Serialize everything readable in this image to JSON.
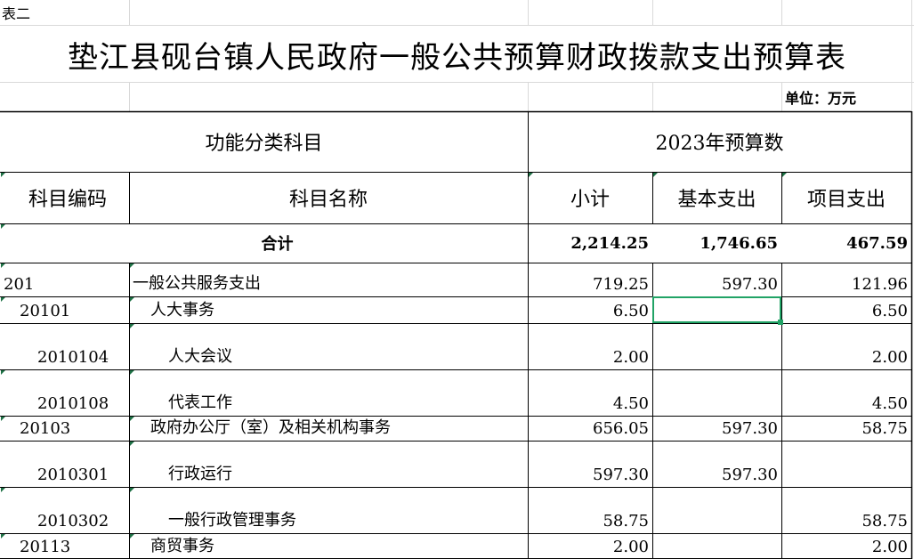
{
  "sheet": {
    "tag": "表二",
    "title": "垫江县砚台镇人民政府一般公共预算财政拨款支出预算表",
    "unit": "单位：万元"
  },
  "header": {
    "func_category": "功能分类科目",
    "budget_year": "2023年预算数",
    "code": "科目编码",
    "name": "科目名称",
    "subtotal": "小计",
    "basic": "基本支出",
    "project": "项目支出"
  },
  "total": {
    "label": "合计",
    "subtotal": "2,214.25",
    "basic": "1,746.65",
    "project": "467.59"
  },
  "rows": [
    {
      "code": "201",
      "name": "一般公共服务支出",
      "subtotal": "719.25",
      "basic": "597.30",
      "project": "121.96"
    },
    {
      "code": "20101",
      "name": "人大事务",
      "subtotal": "6.50",
      "basic": "",
      "project": "6.50"
    },
    {
      "code": "2010104",
      "name": "人大会议",
      "subtotal": "2.00",
      "basic": "",
      "project": "2.00"
    },
    {
      "code": "2010108",
      "name": "代表工作",
      "subtotal": "4.50",
      "basic": "",
      "project": "4.50"
    },
    {
      "code": "20103",
      "name": "政府办公厅（室）及相关机构事务",
      "subtotal": "656.05",
      "basic": "597.30",
      "project": "58.75"
    },
    {
      "code": "2010301",
      "name": "行政运行",
      "subtotal": "597.30",
      "basic": "597.30",
      "project": ""
    },
    {
      "code": "2010302",
      "name": "一般行政管理事务",
      "subtotal": "58.75",
      "basic": "",
      "project": "58.75"
    },
    {
      "code": "20113",
      "name": "商贸事务",
      "subtotal": "2.00",
      "basic": "",
      "project": "2.00"
    }
  ]
}
